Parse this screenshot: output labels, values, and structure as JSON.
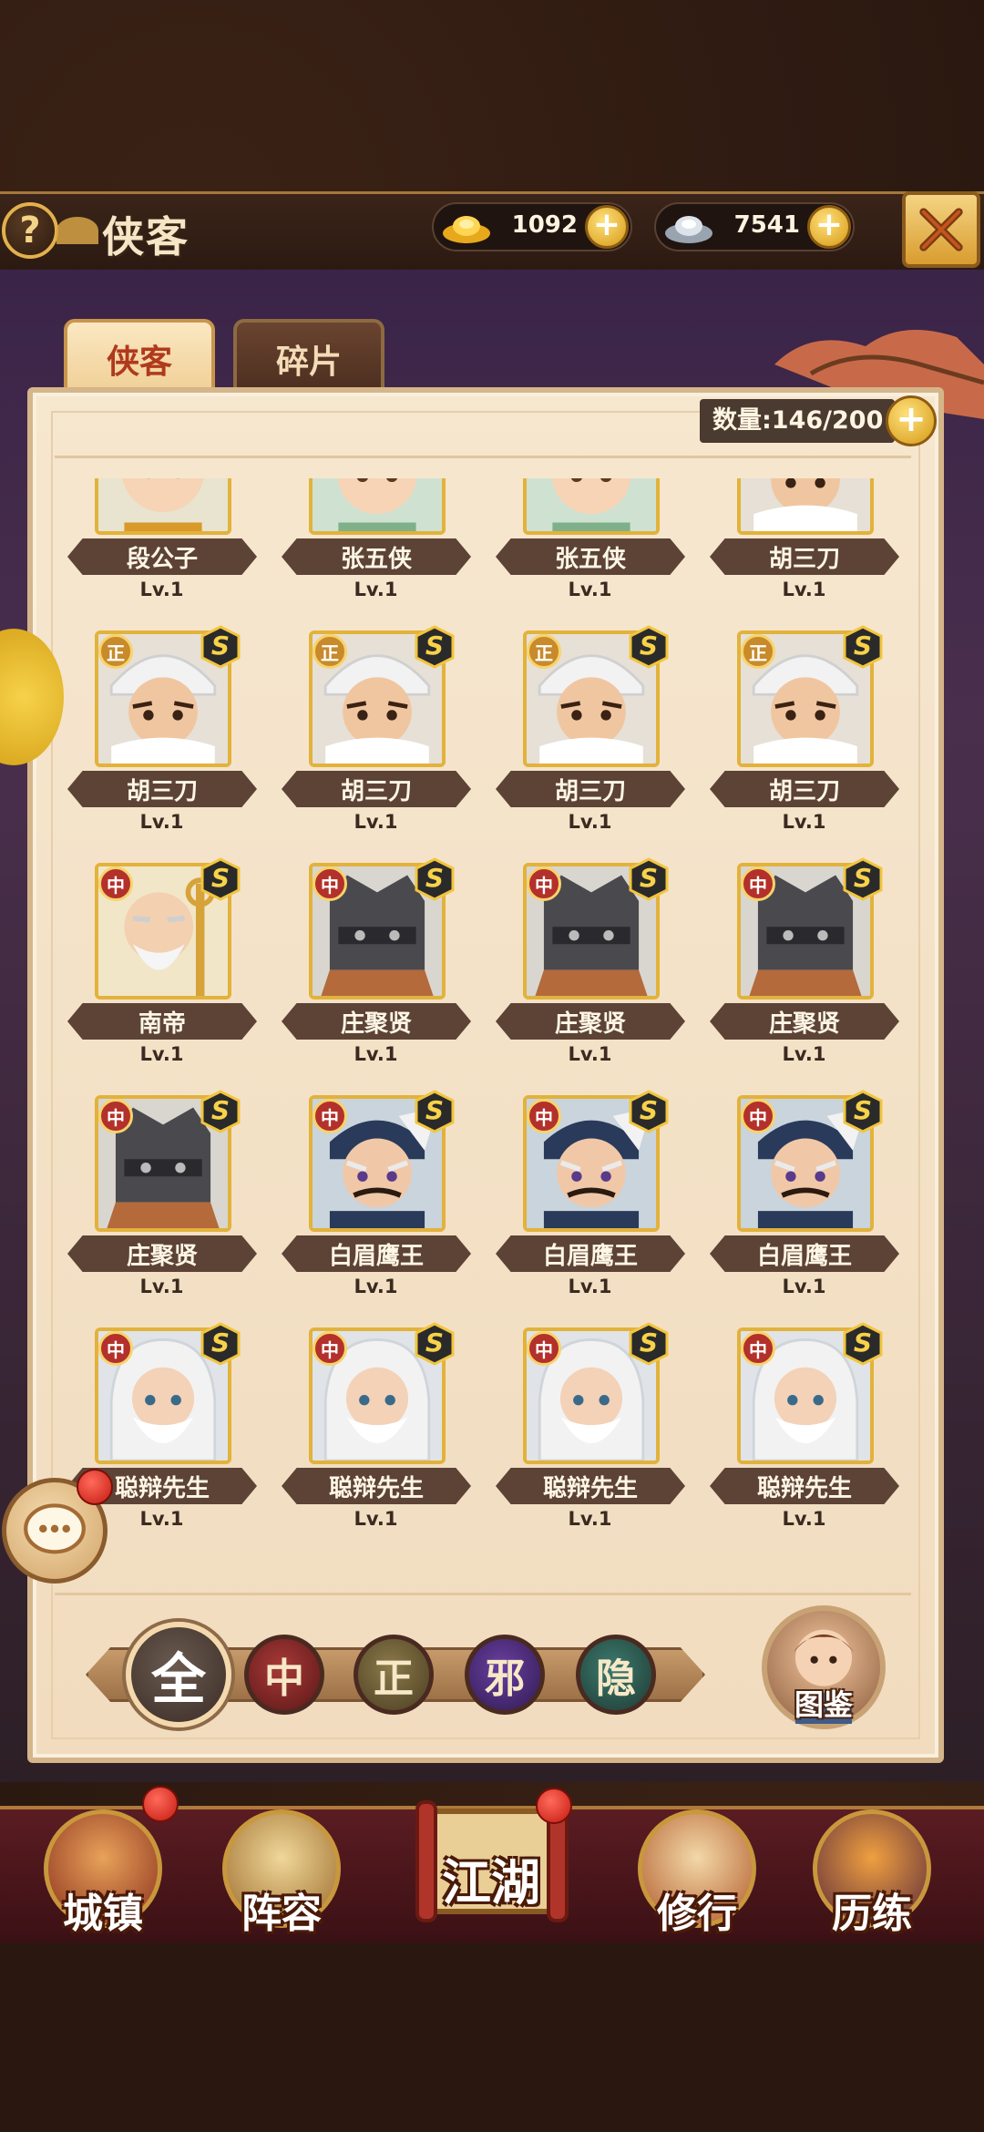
{
  "header": {
    "title": "侠客",
    "help_label": "?",
    "gold": {
      "value": "1092",
      "plus": "+"
    },
    "silver": {
      "value": "7541",
      "plus": "+"
    }
  },
  "tabs": [
    {
      "label": "侠客",
      "active": true
    },
    {
      "label": "碎片",
      "active": false
    }
  ],
  "count": {
    "label": "数量:146/200",
    "plus": "+"
  },
  "heroes": [
    {
      "name": "段公子",
      "level": "Lv.1",
      "faction": "",
      "portrait": "young-hero"
    },
    {
      "name": "张五侠",
      "level": "Lv.1",
      "faction": "",
      "portrait": "teal-hair"
    },
    {
      "name": "张五侠",
      "level": "Lv.1",
      "faction": "",
      "portrait": "teal-hair"
    },
    {
      "name": "胡三刀",
      "level": "Lv.1",
      "faction": "",
      "portrait": "fur-hat"
    },
    {
      "name": "胡三刀",
      "level": "Lv.1",
      "faction": "正",
      "portrait": "fur-hat"
    },
    {
      "name": "胡三刀",
      "level": "Lv.1",
      "faction": "正",
      "portrait": "fur-hat"
    },
    {
      "name": "胡三刀",
      "level": "Lv.1",
      "faction": "正",
      "portrait": "fur-hat"
    },
    {
      "name": "胡三刀",
      "level": "Lv.1",
      "faction": "正",
      "portrait": "fur-hat"
    },
    {
      "name": "南帝",
      "level": "Lv.1",
      "faction": "中",
      "portrait": "monk"
    },
    {
      "name": "庄聚贤",
      "level": "Lv.1",
      "faction": "中",
      "portrait": "iron-mask"
    },
    {
      "name": "庄聚贤",
      "level": "Lv.1",
      "faction": "中",
      "portrait": "iron-mask"
    },
    {
      "name": "庄聚贤",
      "level": "Lv.1",
      "faction": "中",
      "portrait": "iron-mask"
    },
    {
      "name": "庄聚贤",
      "level": "Lv.1",
      "faction": "中",
      "portrait": "iron-mask"
    },
    {
      "name": "白眉鹰王",
      "level": "Lv.1",
      "faction": "中",
      "portrait": "eagle-king"
    },
    {
      "name": "白眉鹰王",
      "level": "Lv.1",
      "faction": "中",
      "portrait": "eagle-king"
    },
    {
      "name": "白眉鹰王",
      "level": "Lv.1",
      "faction": "中",
      "portrait": "eagle-king"
    },
    {
      "name": "聪辩先生",
      "level": "Lv.1",
      "faction": "中",
      "portrait": "white-sage"
    },
    {
      "name": "聪辩先生",
      "level": "Lv.1",
      "faction": "中",
      "portrait": "white-sage"
    },
    {
      "name": "聪辩先生",
      "level": "Lv.1",
      "faction": "中",
      "portrait": "white-sage"
    },
    {
      "name": "聪辩先生",
      "level": "Lv.1",
      "faction": "中",
      "portrait": "white-sage"
    }
  ],
  "grade_badge": "S",
  "filters": [
    {
      "label": "全",
      "key": "all"
    },
    {
      "label": "中",
      "key": "zhong"
    },
    {
      "label": "正",
      "key": "zheng"
    },
    {
      "label": "邪",
      "key": "xie"
    },
    {
      "label": "隐",
      "key": "yin"
    }
  ],
  "atlas_label": "图鉴",
  "nav": [
    {
      "label": "城镇",
      "key": "town"
    },
    {
      "label": "阵容",
      "key": "lineup"
    },
    {
      "label": "江湖",
      "key": "jianghu"
    },
    {
      "label": "修行",
      "key": "training"
    },
    {
      "label": "历练",
      "key": "trial"
    }
  ],
  "colors": {
    "accent_gold": "#e2b23b",
    "panel_bg": "#f6e7cf",
    "nameplate": "#5c4336",
    "faction_zhong": "#b3312a",
    "faction_zheng": "#c88a2a",
    "nav_bg": "#4a1519"
  }
}
